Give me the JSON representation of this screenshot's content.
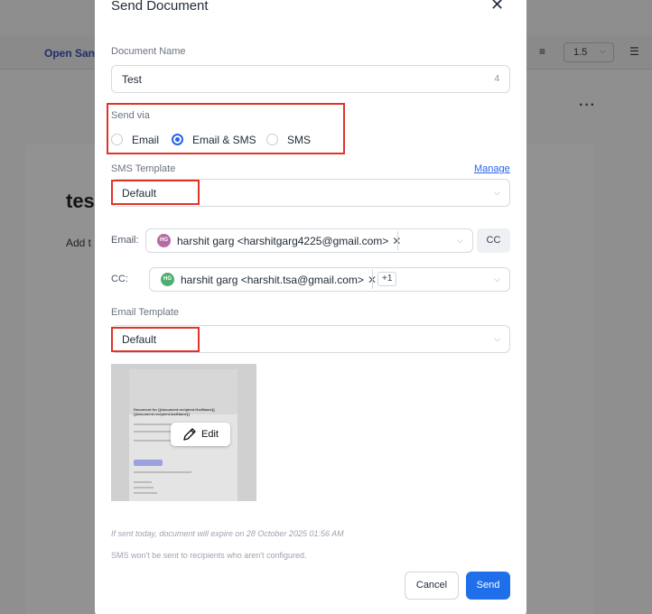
{
  "background": {
    "font_selector": "Open Sans",
    "line_spacing": "1.5",
    "heading": "tes",
    "paragraph": "Add t"
  },
  "modal": {
    "title": "Send Document",
    "document_name": {
      "label": "Document Name",
      "value": "Test",
      "count": "4"
    },
    "send_via": {
      "label": "Send via",
      "options": [
        "Email",
        "Email & SMS",
        "SMS"
      ],
      "selected": "Email & SMS"
    },
    "sms_template": {
      "label": "SMS Template",
      "manage_link": "Manage",
      "value": "Default"
    },
    "email": {
      "label": "Email:",
      "recipient": {
        "initials": "HG",
        "text": "harshit garg <harshitgarg4225@gmail.com>"
      },
      "cc_button": "CC"
    },
    "cc": {
      "label": "CC:",
      "recipient": {
        "initials": "HG",
        "text": "harshit garg <harshit.tsa@gmail.com>"
      },
      "more": "+1"
    },
    "email_template": {
      "label": "Email Template",
      "value": "Default"
    },
    "preview": {
      "heading": "Document for {{document.recipient.firstName}} {{document.recipient.lastName}}",
      "edit_label": "Edit"
    },
    "expiry_note": "If sent today, document will expire on 28 October 2025 01:56 AM",
    "sms_note": "SMS won't be sent to recipients who aren't configured.",
    "cancel_label": "Cancel",
    "send_label": "Send"
  },
  "colors": {
    "accent": "#1f6feb",
    "highlight_box": "#e0342a",
    "avatar_email": "#b56aa6",
    "avatar_cc": "#4caf6e"
  }
}
